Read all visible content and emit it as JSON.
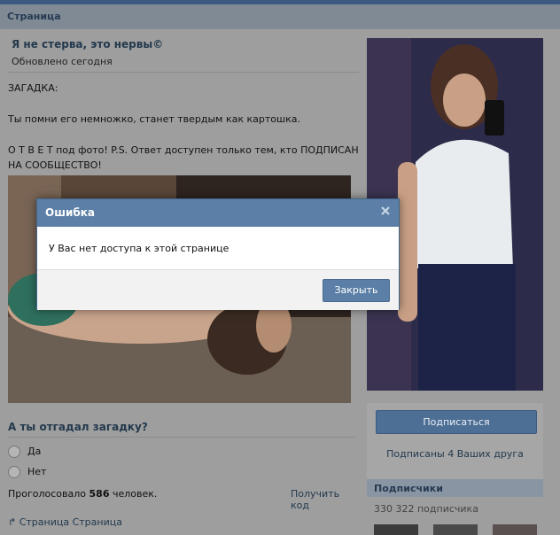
{
  "header": {
    "title": "Страница"
  },
  "group": {
    "title": "Я не стерва, это нервы©",
    "updated": "Обновлено сегодня"
  },
  "post": {
    "lines": [
      "ЗАГАДКА:",
      "Ты помни его немножко, станет твердым как картошка.",
      "О Т В Е Т под фото! P.S. Ответ доступен только тем, кто ПОДПИСАН НА СООБЩЕСТВО!"
    ]
  },
  "poll": {
    "question": "А ты отгадал загадку?",
    "options": [
      "Да",
      "Нет"
    ],
    "voted_prefix": "Проголосовало",
    "voted_count": "586",
    "voted_suffix": "человек.",
    "get_code": "Получить код"
  },
  "footer": {
    "link": "Страница Страница"
  },
  "sidebar": {
    "subscribe_label": "Подписаться",
    "friends_text": "Подписаны 4 Ваших друга",
    "subscribers_title": "Подписчики",
    "subscribers_count": "330 322 подписчика"
  },
  "dialog": {
    "title": "Ошибка",
    "message": "У Вас нет доступа к этой странице",
    "close_label": "Закрыть"
  }
}
